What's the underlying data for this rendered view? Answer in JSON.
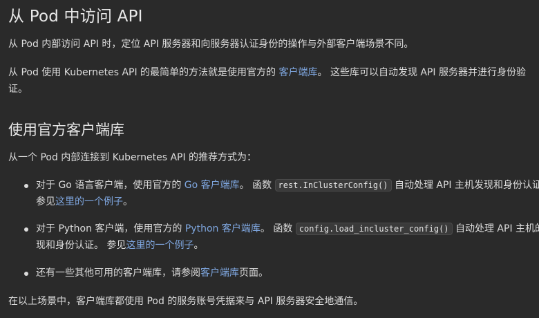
{
  "title": "从 Pod 中访问 API",
  "intro1": "从 Pod 内部访问 API 时，定位 API 服务器和向服务器认证身份的操作与外部客户端场景不同。",
  "intro2": {
    "before": "从 Pod 使用 Kubernetes API 的最简单的方法就是使用官方的 ",
    "link": "客户端库",
    "after": "。 这些库可以自动发现 API 服务器并进行身份验证。"
  },
  "section_title": "使用官方客户端库",
  "section_intro": "从一个 Pod 内部连接到 Kubernetes API 的推荐方式为：",
  "items": [
    {
      "before": "对于 Go 语言客户端，使用官方的 ",
      "link": "Go 客户端库",
      "middle": "。 函数 ",
      "code": "rest.InClusterConfig()",
      "after": " 自动处理 API 主机发现和身份认证。 参见",
      "link2": "这里的一个例子",
      "end": "。"
    },
    {
      "before": "对于 Python 客户端，使用官方的 ",
      "link": "Python 客户端库",
      "middle": "。 函数 ",
      "code": "config.load_incluster_config()",
      "after": " 自动处理 API 主机的发现和身份认证。 参见",
      "link2": "这里的一个例子",
      "end": "。"
    },
    {
      "before": "还有一些其他可用的客户端库，请参阅",
      "link": "客户端库",
      "after": "页面。"
    }
  ],
  "outro": "在以上场景中，客户端库都使用 Pod 的服务账号凭据来与 API 服务器安全地通信。"
}
